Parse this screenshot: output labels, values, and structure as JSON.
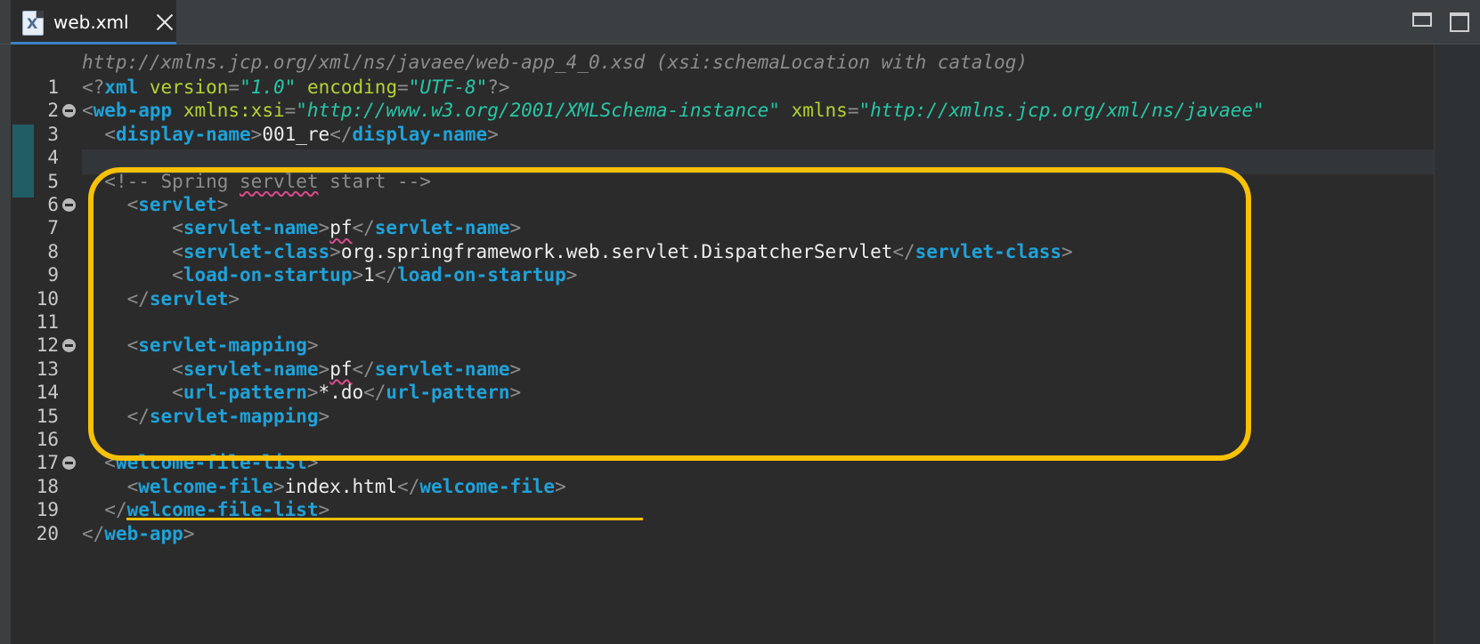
{
  "tab": {
    "file_icon_letter": "X",
    "title": "web.xml",
    "close_icon": "close-icon"
  },
  "window_controls": {
    "minimize_icon": "minimize-icon",
    "maximize_icon": "maximize-icon"
  },
  "editor": {
    "schema_hint": "http://xmlns.jcp.org/xml/ns/javaee/web-app_4_0.xsd (xsi:schemaLocation with catalog)",
    "current_line": 4,
    "folded_lines": [
      2,
      6,
      12,
      17
    ],
    "line_numbers": [
      "1",
      "2",
      "3",
      "4",
      "5",
      "6",
      "7",
      "8",
      "9",
      "10",
      "11",
      "12",
      "13",
      "14",
      "15",
      "16",
      "17",
      "18",
      "19",
      "20"
    ],
    "lines": [
      {
        "segs": [
          [
            "p",
            "<?"
          ],
          [
            "t",
            "xml"
          ],
          [
            "x",
            " "
          ],
          [
            "a",
            "version"
          ],
          [
            "p",
            "="
          ],
          [
            "v",
            "\"1.0\""
          ],
          [
            "x",
            " "
          ],
          [
            "a",
            "encoding"
          ],
          [
            "p",
            "="
          ],
          [
            "v",
            "\"UTF-8\""
          ],
          [
            "p",
            "?>"
          ]
        ]
      },
      {
        "segs": [
          [
            "p",
            "<"
          ],
          [
            "t",
            "web-app"
          ],
          [
            "x",
            " "
          ],
          [
            "a",
            "xmlns:xsi"
          ],
          [
            "p",
            "="
          ],
          [
            "v",
            "\"http://www.w3.org/2001/XMLSchema-instance\""
          ],
          [
            "x",
            " "
          ],
          [
            "a",
            "xmlns"
          ],
          [
            "p",
            "="
          ],
          [
            "v",
            "\"http://xmlns.jcp.org/xml/ns/javaee\""
          ]
        ]
      },
      {
        "segs": [
          [
            "x",
            "  "
          ],
          [
            "p",
            "<"
          ],
          [
            "t",
            "display-name"
          ],
          [
            "p",
            ">"
          ],
          [
            "x",
            "001_re"
          ],
          [
            "p",
            "</"
          ],
          [
            "t",
            "display-name"
          ],
          [
            "p",
            ">"
          ]
        ]
      },
      {
        "segs": []
      },
      {
        "segs": [
          [
            "x",
            "  "
          ],
          [
            "c",
            "<!-- Spring "
          ],
          [
            "c sp",
            "servlet"
          ],
          [
            "c",
            " start -->"
          ]
        ]
      },
      {
        "segs": [
          [
            "x",
            "    "
          ],
          [
            "p",
            "<"
          ],
          [
            "t",
            "servlet"
          ],
          [
            "p",
            ">"
          ]
        ]
      },
      {
        "segs": [
          [
            "x",
            "        "
          ],
          [
            "p",
            "<"
          ],
          [
            "t",
            "servlet-name"
          ],
          [
            "p",
            ">"
          ],
          [
            "x sp",
            "pf"
          ],
          [
            "p",
            "</"
          ],
          [
            "t",
            "servlet-name"
          ],
          [
            "p",
            ">"
          ]
        ]
      },
      {
        "segs": [
          [
            "x",
            "        "
          ],
          [
            "p",
            "<"
          ],
          [
            "t",
            "servlet-class"
          ],
          [
            "p",
            ">"
          ],
          [
            "x",
            "org.springframework.web.servlet.DispatcherServlet"
          ],
          [
            "p",
            "</"
          ],
          [
            "t",
            "servlet-class"
          ],
          [
            "p",
            ">"
          ]
        ]
      },
      {
        "segs": [
          [
            "x",
            "        "
          ],
          [
            "p",
            "<"
          ],
          [
            "t",
            "load-on-startup"
          ],
          [
            "p",
            ">"
          ],
          [
            "x",
            "1"
          ],
          [
            "p",
            "</"
          ],
          [
            "t",
            "load-on-startup"
          ],
          [
            "p",
            ">"
          ]
        ]
      },
      {
        "segs": [
          [
            "x",
            "    "
          ],
          [
            "p",
            "</"
          ],
          [
            "t",
            "servlet"
          ],
          [
            "p",
            ">"
          ]
        ]
      },
      {
        "segs": []
      },
      {
        "segs": [
          [
            "x",
            "    "
          ],
          [
            "p",
            "<"
          ],
          [
            "t",
            "servlet-mapping"
          ],
          [
            "p",
            ">"
          ]
        ]
      },
      {
        "segs": [
          [
            "x",
            "        "
          ],
          [
            "p",
            "<"
          ],
          [
            "t",
            "servlet-name"
          ],
          [
            "p",
            ">"
          ],
          [
            "x sp",
            "pf"
          ],
          [
            "p",
            "</"
          ],
          [
            "t",
            "servlet-name"
          ],
          [
            "p",
            ">"
          ]
        ]
      },
      {
        "segs": [
          [
            "x",
            "        "
          ],
          [
            "p",
            "<"
          ],
          [
            "t",
            "url-pattern"
          ],
          [
            "p",
            ">"
          ],
          [
            "x",
            "*.do"
          ],
          [
            "p",
            "</"
          ],
          [
            "t",
            "url-pattern"
          ],
          [
            "p",
            ">"
          ]
        ]
      },
      {
        "segs": [
          [
            "x",
            "    "
          ],
          [
            "p",
            "</"
          ],
          [
            "t",
            "servlet-mapping"
          ],
          [
            "p",
            ">"
          ]
        ]
      },
      {
        "segs": []
      },
      {
        "segs": [
          [
            "x",
            "  "
          ],
          [
            "p",
            "<"
          ],
          [
            "t",
            "welcome-file-list"
          ],
          [
            "p",
            ">"
          ]
        ]
      },
      {
        "segs": [
          [
            "x",
            "    "
          ],
          [
            "p",
            "<"
          ],
          [
            "t",
            "welcome-file"
          ],
          [
            "p",
            ">"
          ],
          [
            "x",
            "index.html"
          ],
          [
            "p",
            "</"
          ],
          [
            "t",
            "welcome-file"
          ],
          [
            "p",
            ">"
          ]
        ]
      },
      {
        "segs": [
          [
            "x",
            "  "
          ],
          [
            "p",
            "</"
          ],
          [
            "t",
            "welcome-file-list"
          ],
          [
            "p",
            ">"
          ]
        ]
      },
      {
        "segs": [
          [
            "p",
            "</"
          ],
          [
            "t",
            "web-app"
          ],
          [
            "p",
            ">"
          ]
        ]
      }
    ]
  },
  "colors": {
    "background": "#2b2b2b",
    "tag": "#1fa2d9",
    "attribute": "#b3d334",
    "attribute_value": "#27c7a6",
    "comment": "#8c8c8c",
    "highlight_annotation": "#f7c106",
    "spellcheck_underline": "#d94a8c"
  }
}
